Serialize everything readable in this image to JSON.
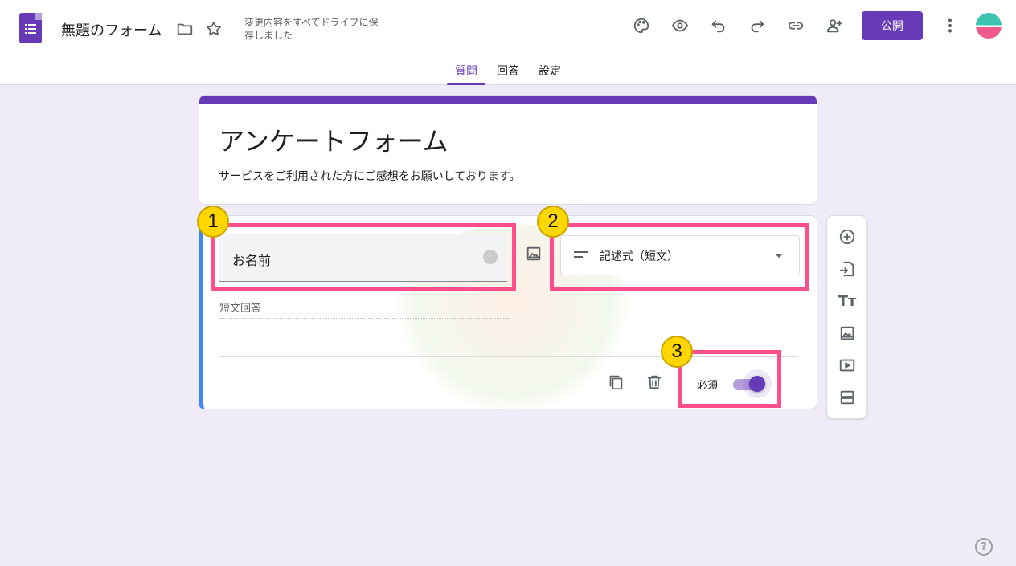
{
  "header": {
    "doc_title": "無題のフォーム",
    "save_status": "変更内容をすべてドライブに保存しました",
    "publish_label": "公開"
  },
  "tabs": [
    {
      "label": "質問",
      "active": true
    },
    {
      "label": "回答",
      "active": false
    },
    {
      "label": "設定",
      "active": false
    }
  ],
  "form": {
    "title": "アンケートフォーム",
    "description": "サービスをご利用された方にご感想をお願いしております。"
  },
  "question": {
    "text": "お名前",
    "type_label": "記述式（短文）",
    "answer_hint": "短文回答",
    "required_label": "必須",
    "required": true
  },
  "callouts": [
    "1",
    "2",
    "3"
  ],
  "sidebar_icons": [
    "add-question-icon",
    "import-questions-icon",
    "add-title-icon",
    "add-image-icon",
    "add-video-icon",
    "add-section-icon"
  ],
  "colors": {
    "accent": "#673ab7",
    "background": "#f0ebf8",
    "highlight": "#ff4f8b",
    "badge": "#ffd600"
  }
}
